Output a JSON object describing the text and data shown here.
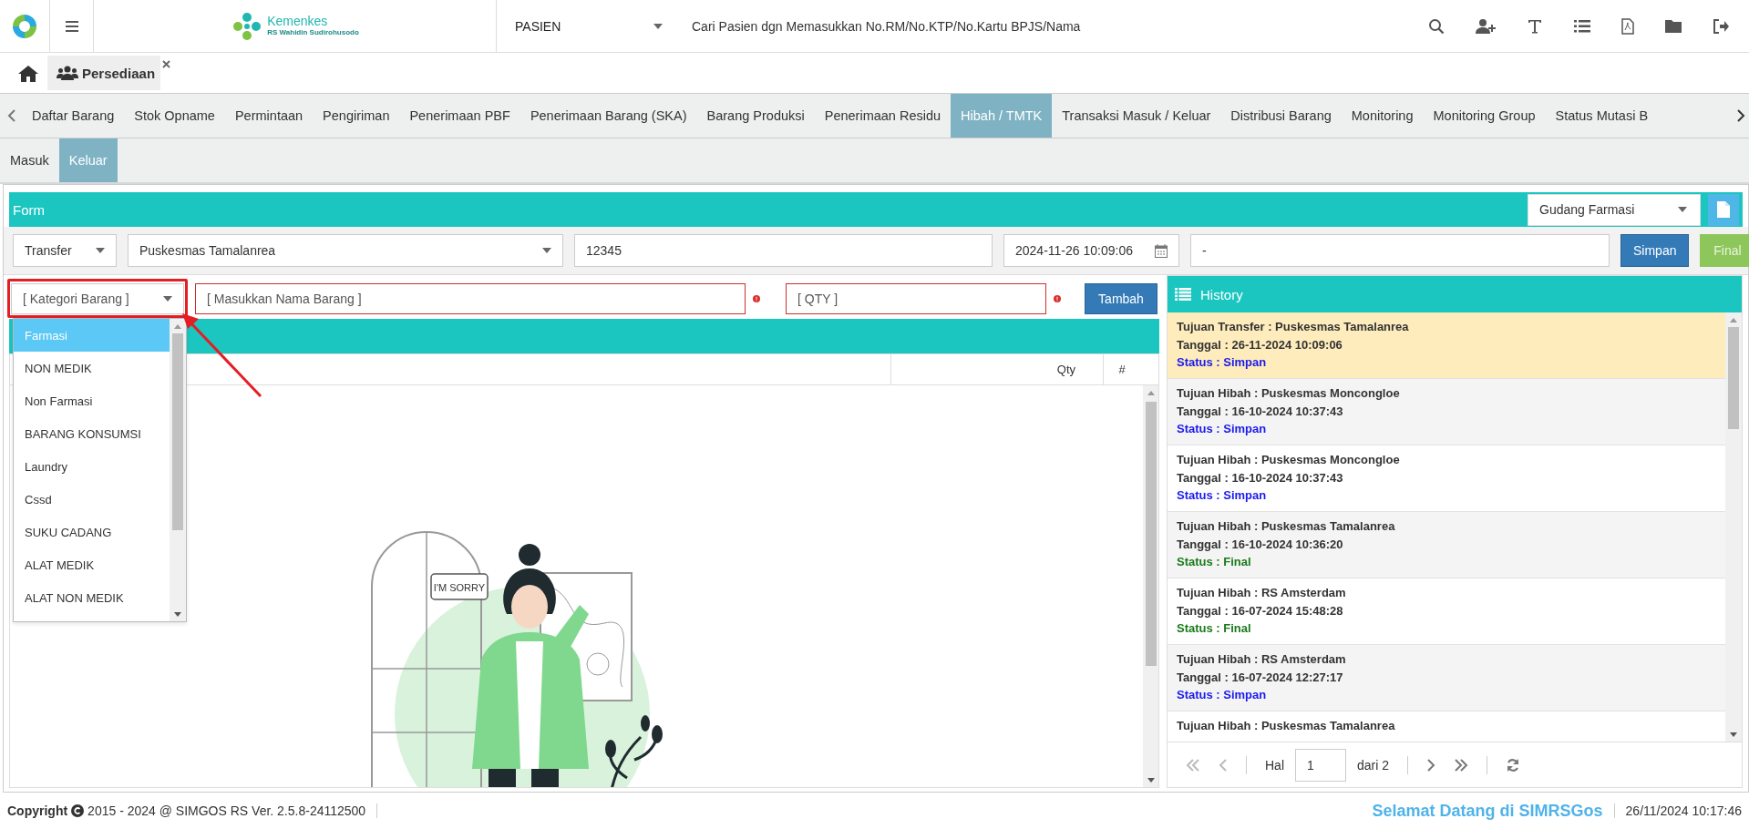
{
  "header": {
    "logo_title": "Kemenkes",
    "logo_subtitle": "RS Wahidin Sudirohusodo",
    "search_category": "PASIEN",
    "search_placeholder": "Cari Pasien dgn Memasukkan No.RM/No.KTP/No.Kartu BPJS/Nama"
  },
  "module_tabs": [
    {
      "label": "Persediaan",
      "selected": true
    }
  ],
  "nav_tabs": [
    {
      "label": "Daftar Barang",
      "selected": false
    },
    {
      "label": "Stok Opname",
      "selected": false
    },
    {
      "label": "Permintaan",
      "selected": false
    },
    {
      "label": "Pengiriman",
      "selected": false
    },
    {
      "label": "Penerimaan PBF",
      "selected": false
    },
    {
      "label": "Penerimaan Barang (SKA)",
      "selected": false
    },
    {
      "label": "Barang Produksi",
      "selected": false
    },
    {
      "label": "Penerimaan Residu",
      "selected": false
    },
    {
      "label": "Hibah / TMTK",
      "selected": true
    },
    {
      "label": "Transaksi Masuk / Keluar",
      "selected": false
    },
    {
      "label": "Distribusi Barang",
      "selected": false
    },
    {
      "label": "Monitoring",
      "selected": false
    },
    {
      "label": "Monitoring Group",
      "selected": false
    },
    {
      "label": "Status Mutasi B",
      "selected": false
    }
  ],
  "sub_tabs": [
    {
      "label": "Masuk",
      "selected": false
    },
    {
      "label": "Keluar",
      "selected": true
    }
  ],
  "form": {
    "title": "Form",
    "warehouse": "Gudang Farmasi",
    "type": "Transfer",
    "destination": "Puskesmas Tamalanrea",
    "number": "12345",
    "date": "2024-11-26 10:09:06",
    "note": "-",
    "save_button": "Simpan",
    "final_button": "Final"
  },
  "item_entry": {
    "category_placeholder": "[ Kategori Barang ]",
    "name_placeholder": "[ Masukkan Nama Barang ]",
    "qty_placeholder": "[ QTY ]",
    "add_button": "Tambah",
    "category_options": [
      {
        "label": "Farmasi",
        "selected": true
      },
      {
        "label": "NON MEDIK",
        "selected": false
      },
      {
        "label": "Non Farmasi",
        "selected": false
      },
      {
        "label": "BARANG KONSUMSI",
        "selected": false
      },
      {
        "label": "Laundry",
        "selected": false
      },
      {
        "label": "Cssd",
        "selected": false
      },
      {
        "label": "SUKU CADANG",
        "selected": false
      },
      {
        "label": "ALAT MEDIK",
        "selected": false
      },
      {
        "label": "ALAT NON MEDIK",
        "selected": false
      }
    ]
  },
  "table": {
    "columns": [
      "",
      "Qty",
      "#"
    ],
    "empty_illustration_text": "I'M SORRY"
  },
  "history": {
    "title": "History",
    "items": [
      {
        "title": "Tujuan Transfer : Puskesmas Tamalanrea",
        "date": "Tanggal : 26-11-2024 10:09:06",
        "status": "Status : Simpan",
        "color": "#1a1aee",
        "selected": true
      },
      {
        "title": "Tujuan Hibah : Puskesmas Moncongloe",
        "date": "Tanggal : 16-10-2024 10:37:43",
        "status": "Status : Simpan",
        "color": "#1a1aee",
        "selected": false
      },
      {
        "title": "Tujuan Hibah : Puskesmas Moncongloe",
        "date": "Tanggal : 16-10-2024 10:37:43",
        "status": "Status : Simpan",
        "color": "#1a1aee",
        "selected": false
      },
      {
        "title": "Tujuan Hibah : Puskesmas Tamalanrea",
        "date": "Tanggal : 16-10-2024 10:36:20",
        "status": "Status : Final",
        "color": "#1a7a1a",
        "selected": false
      },
      {
        "title": "Tujuan Hibah : RS Amsterdam",
        "date": "Tanggal : 16-07-2024 15:48:28",
        "status": "Status : Final",
        "color": "#1a7a1a",
        "selected": false
      },
      {
        "title": "Tujuan Hibah : RS Amsterdam",
        "date": "Tanggal : 16-07-2024 12:27:17",
        "status": "Status : Simpan",
        "color": "#1a1aee",
        "selected": false
      },
      {
        "title": "Tujuan Hibah : Puskesmas Tamalanrea",
        "selected": false
      }
    ],
    "pager": {
      "label": "Hal",
      "page": "1",
      "total": "dari 2"
    }
  },
  "footer": {
    "copyright_label": "Copyright",
    "copyright_text": "2015 - 2024 @ SIMGOS RS Ver. 2.5.8-24112500",
    "welcome": "Selamat Datang di SIMRSGos",
    "datetime": "26/11/2024 10:17:46"
  }
}
